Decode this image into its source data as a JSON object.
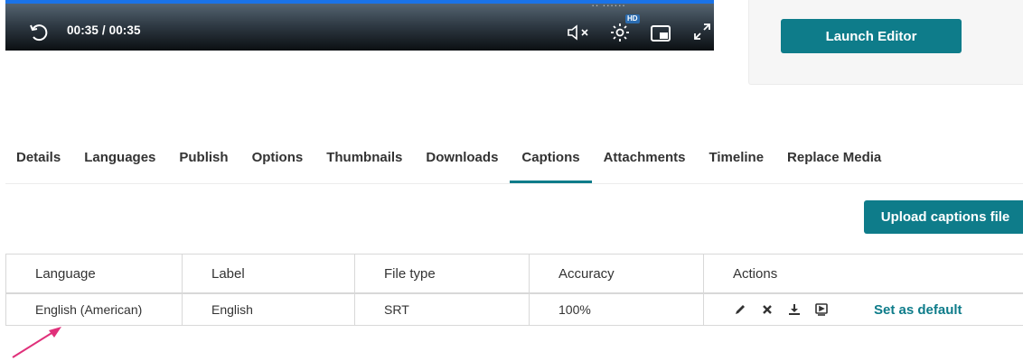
{
  "player": {
    "time": "00:35 / 00:35",
    "overlay_fragment": "·· ······",
    "hd_badge": "HD",
    "icons": [
      "replay-icon",
      "mute-icon",
      "settings-icon",
      "pip-icon",
      "fullscreen-icon"
    ],
    "progress_fraction": 1.0
  },
  "editor": {
    "launch_label": "Launch Editor"
  },
  "tabs": [
    {
      "label": "Details"
    },
    {
      "label": "Languages"
    },
    {
      "label": "Publish"
    },
    {
      "label": "Options"
    },
    {
      "label": "Thumbnails"
    },
    {
      "label": "Downloads"
    },
    {
      "label": "Captions",
      "active": true
    },
    {
      "label": "Attachments"
    },
    {
      "label": "Timeline"
    },
    {
      "label": "Replace Media"
    }
  ],
  "captions": {
    "upload_label": "Upload captions file",
    "columns": [
      "Language",
      "Label",
      "File type",
      "Accuracy",
      "Actions"
    ],
    "rows": [
      {
        "language": "English (American)",
        "label": "English",
        "file_type": "SRT",
        "accuracy": "100%",
        "actions": [
          "edit-icon",
          "delete-icon",
          "download-icon",
          "preview-icon"
        ],
        "set_default_label": "Set as default"
      }
    ]
  },
  "colors": {
    "accent": "#0e7c8a",
    "progress": "#1a73e8",
    "annotation_arrow": "#e0307a"
  }
}
